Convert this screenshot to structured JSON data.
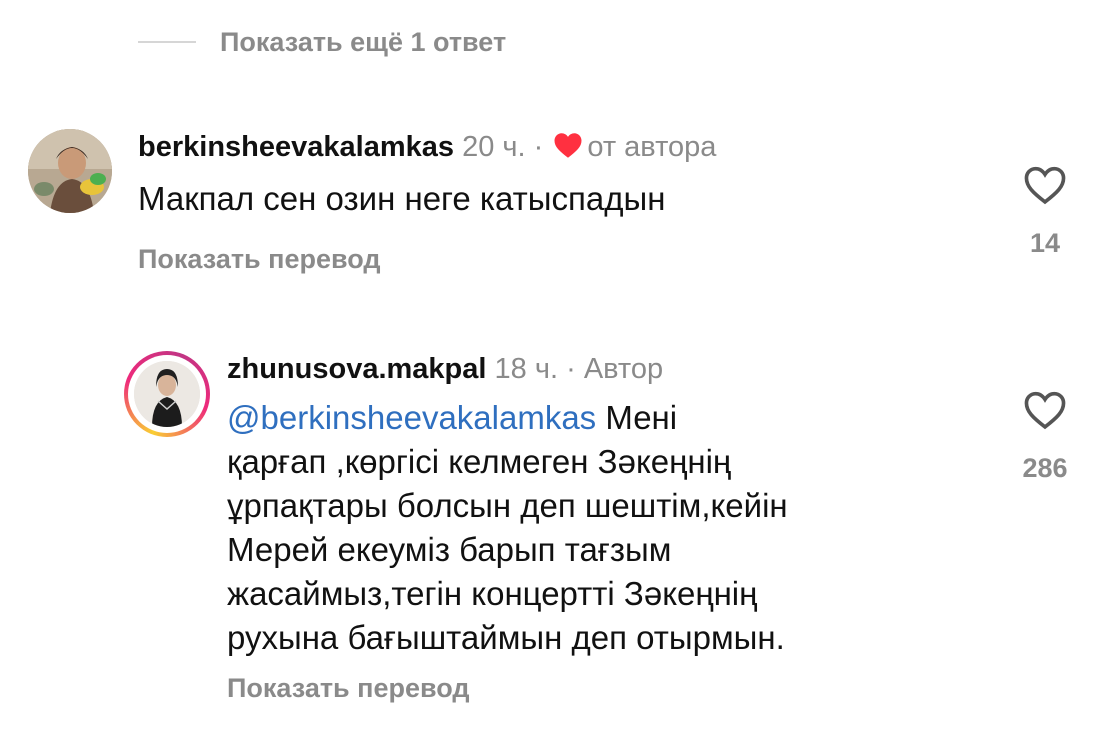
{
  "replies_toggle": {
    "label": "Показать ещё 1 ответ"
  },
  "comments": [
    {
      "username": "berkinsheevakalamkas",
      "time": "20 ч.",
      "separator": "·",
      "badge": "от автора",
      "text": "Макпал сен озин неге катыспадын",
      "translate": "Показать перевод",
      "likes": "14"
    },
    {
      "username": "zhunusova.makpal",
      "time": "18 ч.",
      "separator": "·",
      "badge": "Автор",
      "mention": "@berkinsheevakalamkas",
      "text_lines": [
        " Мені",
        "қарғап ,көргісі келмеген Зәкеңнің",
        "ұрпақтары болсын деп шештім,кейін",
        "Мерей екеуміз барып тағзым",
        "жасаймыз,тегін концертті Зәкеңнің",
        "рухына бағыштаймын деп отырмын."
      ],
      "translate": "Показать перевод",
      "likes": "286"
    }
  ],
  "icons": {
    "liked_by_author": "heart-filled-icon",
    "like_button": "heart-outline-icon"
  },
  "colors": {
    "heart_red": "#ff3040",
    "mention_blue": "#2f6fbf",
    "muted_gray": "#8a8a8a"
  }
}
